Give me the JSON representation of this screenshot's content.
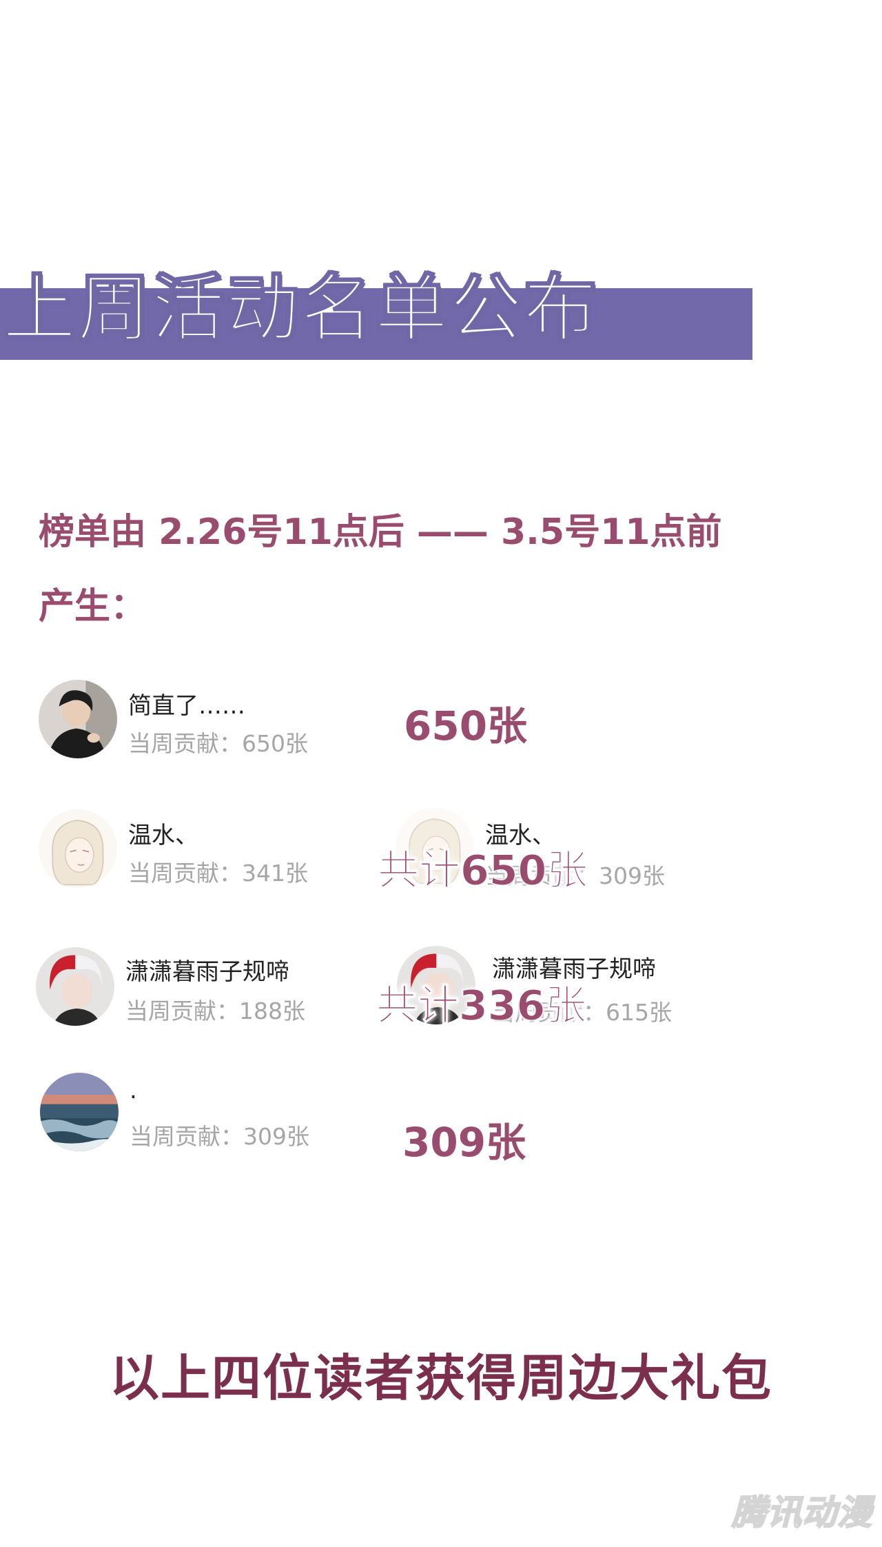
{
  "banner": {
    "title": "上周活动名单公布"
  },
  "period": {
    "line1": "榜单由 2.26号11点后 —— 3.5号11点前",
    "line2": "产生："
  },
  "entries": [
    {
      "name": "简直了……",
      "contribution": "当周贡献：650张",
      "total": "650张"
    },
    {
      "name": "温水、",
      "contribution": "当周贡献：341张"
    },
    {
      "name": "温水、",
      "contribution": "当周贡献：309张"
    },
    {
      "name": "潇潇暮雨子规啼",
      "contribution": "当周贡献：188张"
    },
    {
      "name": "潇潇暮雨子规啼",
      "contribution": "当周贡献：615张"
    },
    {
      "name": ".",
      "contribution": "当周贡献：309张",
      "total": "309张"
    }
  ],
  "overlays": {
    "wenshui_total": "共计650张",
    "xiaoxiao_total": "共计336张"
  },
  "footer": "以上四位读者获得周边大礼包",
  "watermark": "腾讯动漫",
  "colors": {
    "banner": "#7169a9",
    "accent": "#9a4c6e",
    "footer": "#7b2f4c",
    "muted": "#a6a6a6"
  }
}
